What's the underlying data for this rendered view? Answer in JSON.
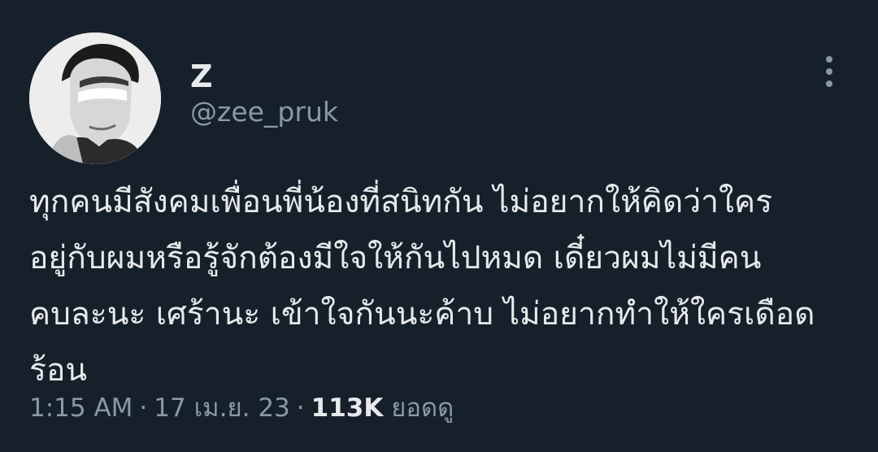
{
  "author": {
    "display_name": "Z",
    "handle": "@zee_pruk"
  },
  "icons": {
    "more": "more-vertical-icon",
    "avatar": "profile-photo"
  },
  "tweet": {
    "lines": [
      "ทุกคนมีสังคมเพื่อนพี่น้องที่สนิทกัน ไม่อยากให้คิดว่าใคร",
      "อยู่กับผมหรือรู้จักต้องมีใจให้กันไปหมด เดี๋ยวผมไม่มีคน",
      "คบละนะ เศร้านะ เข้าใจกันนะค้าบ ไม่อยากทำให้ใครเดือด",
      "ร้อน"
    ]
  },
  "meta": {
    "time": "1:15 AM",
    "separator": "·",
    "date": "17 เม.ย. 23",
    "views_count": "113K",
    "views_label": "ยอดดู"
  },
  "colors": {
    "background": "#15202b",
    "primary_text": "#e7e9ea",
    "secondary_text": "#8b98a5"
  }
}
